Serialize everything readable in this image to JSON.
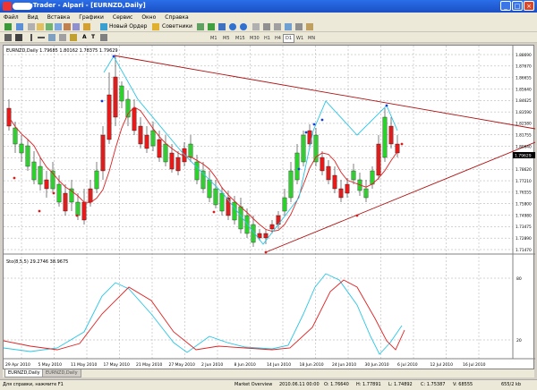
{
  "window": {
    "title": "MetaTrader - Alpari - [EURNZD,Daily]"
  },
  "menu": [
    "Файл",
    "Вид",
    "Вставка",
    "Графики",
    "Сервис",
    "Окно",
    "Справка"
  ],
  "toolbar": {
    "new_order": "Новый Ордер",
    "advisors": "Советники",
    "letter_a": "A",
    "letter_t": "T",
    "timeframes": [
      "M1",
      "M5",
      "M15",
      "M30",
      "H1",
      "H4",
      "D1",
      "W1",
      "MN"
    ],
    "selected_timeframe": "D1"
  },
  "chart": {
    "header": "EURNZD,Daily 1.79685 1.80162 1.78375 1.79629",
    "price_labels": [
      "1.88690",
      "1.87670",
      "1.86655",
      "1.85640",
      "1.84625",
      "1.83590",
      "1.82580",
      "1.81755",
      "1.80640",
      "1.79629",
      "1.78620",
      "1.77210",
      "1.76555",
      "1.75800",
      "1.74980",
      "1.73475",
      "1.72890",
      "1.71470"
    ],
    "current_price": "1.79629",
    "stoch_header": "Sto(8,5,5) 29.2746 38.9675",
    "stoch_levels": [
      "80",
      "20"
    ],
    "date_labels": [
      "29 Apr 2010",
      "5 May 2010",
      "11 May 2010",
      "17 May 2010",
      "21 May 2010",
      "27 May 2010",
      "2 Jun 2010",
      "8 Jun 2010",
      "14 Jun 2010",
      "18 Jun 2010",
      "24 Jun 2010",
      "30 Jun 2010",
      "6 Jul 2010",
      "12 Jul 2010",
      "16 Jul 2010"
    ],
    "colors": {
      "bull": "#2ed02e",
      "bear": "#e31b1b",
      "ma": "#e02020",
      "fast": "#2ac6e6",
      "trend": "#b01010",
      "grid": "#a8a8a8"
    }
  },
  "tabs": [
    "EURNZD,Daily",
    "EURNZD,Daily"
  ],
  "status": {
    "help": "Для справки, нажмите F1",
    "profile": "Market Overview",
    "datetime": "2010.06.11 00:00",
    "open": "O: 1.76640",
    "high": "H: 1.77891",
    "low": "L: 1.74892",
    "close": "C: 1.75387",
    "volume": "V: 68555",
    "traffic": "655/2 kb"
  }
}
